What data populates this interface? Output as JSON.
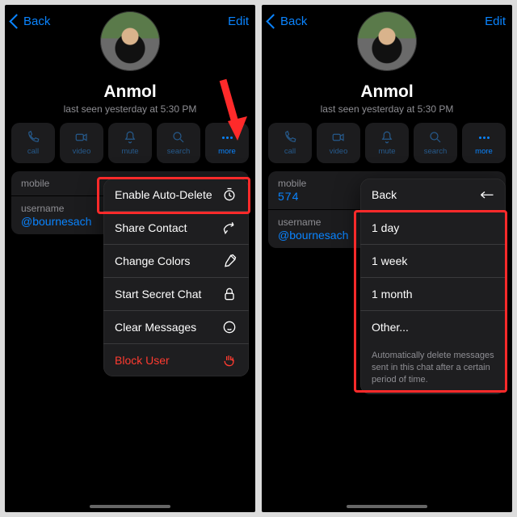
{
  "left": {
    "nav": {
      "back": "Back",
      "edit": "Edit"
    },
    "profile": {
      "name": "Anmol",
      "lastseen": "last seen yesterday at 5:30 PM"
    },
    "actions": {
      "call": "call",
      "video": "video",
      "mute": "mute",
      "search": "search",
      "more": "more"
    },
    "info": {
      "mobile_label": "mobile",
      "username_label": "username",
      "username_value": "@bournesach"
    },
    "menu": {
      "auto_delete": "Enable Auto-Delete",
      "share": "Share Contact",
      "colors": "Change Colors",
      "secret": "Start Secret Chat",
      "clear": "Clear Messages",
      "block": "Block User"
    }
  },
  "right": {
    "nav": {
      "back": "Back",
      "edit": "Edit"
    },
    "profile": {
      "name": "Anmol",
      "lastseen": "last seen yesterday at 5:30 PM"
    },
    "actions": {
      "call": "call",
      "video": "video",
      "mute": "mute",
      "search": "search",
      "more": "more"
    },
    "info": {
      "mobile_label": "mobile",
      "phone_partial": "574",
      "username_label": "username",
      "username_value": "@bournesach"
    },
    "menu": {
      "back": "Back",
      "d1": "1 day",
      "w1": "1 week",
      "m1": "1 month",
      "other": "Other...",
      "desc": "Automatically delete messages sent in this chat after a certain period of time."
    }
  }
}
